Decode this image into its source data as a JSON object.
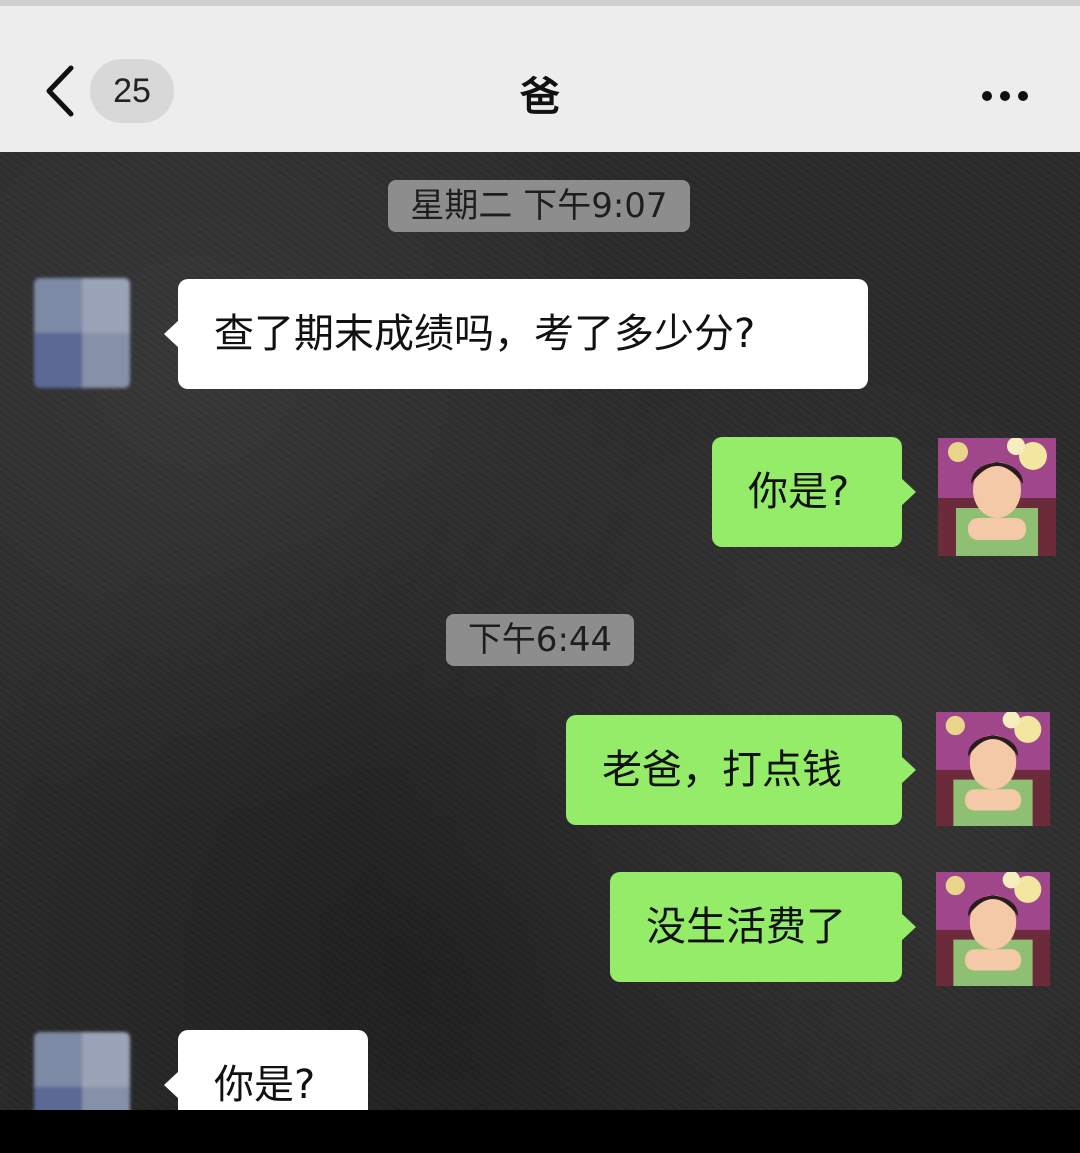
{
  "header": {
    "back_icon": "chevron-left-icon",
    "unread_count": "25",
    "title": "爸",
    "more_icon": "more-horizontal-icon"
  },
  "messages": [
    {
      "type": "timestamp",
      "text": "星期二 下午9:07"
    },
    {
      "type": "incoming",
      "sender": "爸",
      "text": "查了期末成绩吗，考了多少分?"
    },
    {
      "type": "outgoing",
      "text": "你是?"
    },
    {
      "type": "timestamp",
      "text": "下午6:44"
    },
    {
      "type": "outgoing",
      "text": "老爸，打点钱"
    },
    {
      "type": "outgoing",
      "text": "没生活费了"
    },
    {
      "type": "incoming",
      "sender": "爸",
      "text": "你是?"
    }
  ],
  "colors": {
    "header_bg": "#ededed",
    "incoming_bubble": "#ffffff",
    "outgoing_bubble": "#95ec69",
    "timestamp_bg": "#8d8d8d"
  }
}
